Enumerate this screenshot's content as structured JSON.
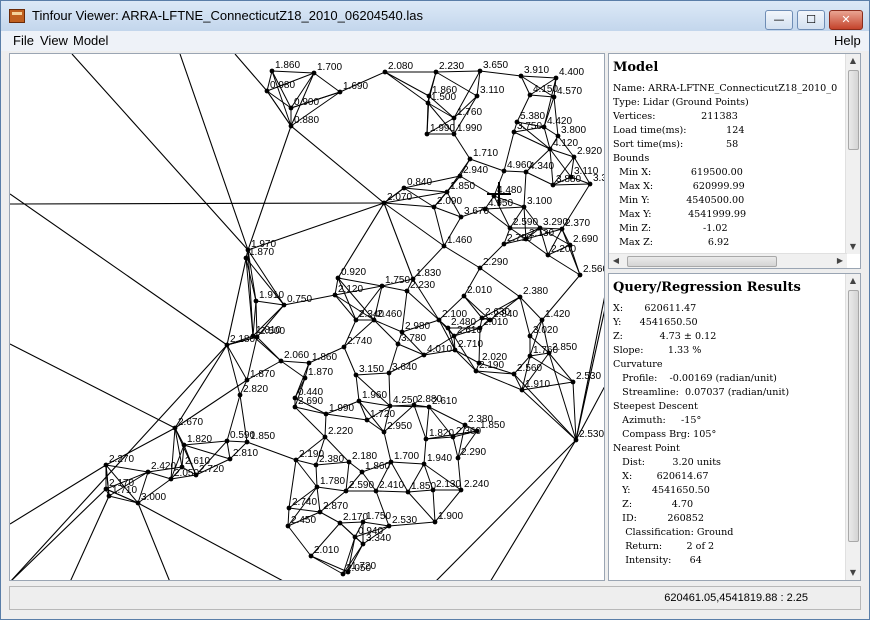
{
  "window": {
    "title": "Tinfour Viewer: ARRA-LFTNE_ConnecticutZ18_2010_06204540.las",
    "min_glyph": "—",
    "max_glyph": "☐",
    "close_glyph": "✕"
  },
  "menu": {
    "file": "File",
    "view": "View",
    "model": "Model",
    "help": "Help"
  },
  "model_panel": {
    "title": "Model",
    "body": "Name: ARRA-LFTNE_ConnecticutZ18_2010_0\nType: Lidar (Ground Points)\nVertices:               211383\nLoad time(ms):             124\nSort time(ms):              58\nBounds\n  Min X:             619500.00\n  Max X:             620999.99\n  Min Y:            4540500.00\n  Max Y:            4541999.99\n  Min Z:                 -1.02\n  Max Z:                  6.92"
  },
  "query_panel": {
    "title": "Query/Regression Results",
    "body": "X:       620611.47\nY:      4541650.50\nZ:            4.73 ± 0.12\nSlope:        1.33 %\nCurvature\n   Profile:    -0.00169 (radian/unit)\n   Streamline:  0.07037 (radian/unit)\nSteepest Descent\n   Azimuth:     -15°\n   Compass Brg: 105°\nNearest Point\n   Dist:         3.20 units\n   X:        620614.67\n   Y:       4541650.50\n   Z:             4.70\n   ID:          260852\n    Classification: Ground\n    Return:        2 of 2\n    Intensity:      64"
  },
  "status": {
    "coords": "620461.05,4541819.88 : 2.25"
  },
  "tin": {
    "points": [
      {
        "label": "1.860",
        "z": 1.86
      },
      {
        "label": "1.700",
        "z": 1.7
      },
      {
        "label": "2.080",
        "z": 2.08
      },
      {
        "label": "2.230",
        "z": 2.23
      },
      {
        "label": "3.650",
        "z": 3.65
      },
      {
        "label": "3.910",
        "z": 3.91
      },
      {
        "label": "4.400",
        "z": 4.4
      },
      {
        "label": "0.980",
        "z": 0.98
      },
      {
        "label": "1.690",
        "z": 1.69
      },
      {
        "label": "1.860",
        "z": 1.86
      },
      {
        "label": "3.110",
        "z": 3.11
      },
      {
        "label": "4.150",
        "z": 4.15
      },
      {
        "label": "4.570",
        "z": 4.57
      },
      {
        "label": "0.900",
        "z": 0.9
      },
      {
        "label": "1.500",
        "z": 1.5
      },
      {
        "label": "0.880",
        "z": 0.88
      },
      {
        "label": "1.760",
        "z": 1.76
      },
      {
        "label": "5.380",
        "z": 5.38
      },
      {
        "label": "4.420",
        "z": 4.42
      },
      {
        "label": "1.990",
        "z": 1.99
      },
      {
        "label": "1.990",
        "z": 1.99
      },
      {
        "label": "3.750",
        "z": 3.75
      },
      {
        "label": "3.800",
        "z": 3.8
      },
      {
        "label": "4.120",
        "z": 4.12
      },
      {
        "label": "1.710",
        "z": 1.71
      },
      {
        "label": "2.920",
        "z": 2.92
      },
      {
        "label": "4.960",
        "z": 4.96
      },
      {
        "label": "4.340",
        "z": 4.34
      },
      {
        "label": "2.940",
        "z": 2.94
      },
      {
        "label": "3.110",
        "z": 3.11
      },
      {
        "label": "3.880",
        "z": 3.88
      },
      {
        "label": "3.360",
        "z": 3.36
      },
      {
        "label": "0.840",
        "z": 0.84
      },
      {
        "label": "1.850",
        "z": 1.85
      },
      {
        "label": "4.480",
        "z": 4.48
      },
      {
        "label": "2.070",
        "z": 2.07
      },
      {
        "label": "2.090",
        "z": 2.09
      },
      {
        "label": "4.950",
        "z": 4.95
      },
      {
        "label": "3.100",
        "z": 3.1
      },
      {
        "label": "3.670",
        "z": 3.67
      },
      {
        "label": "2.590",
        "z": 2.59
      },
      {
        "label": "3.290",
        "z": 3.29
      },
      {
        "label": "2.130",
        "z": 2.13
      },
      {
        "label": "2.370",
        "z": 2.37
      },
      {
        "label": "1.460",
        "z": 1.46
      },
      {
        "label": "2.790",
        "z": 2.79
      },
      {
        "label": "2.690",
        "z": 2.69
      },
      {
        "label": "1.970",
        "z": 1.97
      },
      {
        "label": "1.870",
        "z": 1.87
      },
      {
        "label": "2.200",
        "z": 2.2
      },
      {
        "label": "2.290",
        "z": 2.29
      },
      {
        "label": "0.920",
        "z": 0.92
      },
      {
        "label": "2.560",
        "z": 2.56
      },
      {
        "label": "1.830",
        "z": 1.83
      },
      {
        "label": "2.010",
        "z": 2.01
      },
      {
        "label": "2.120",
        "z": 2.12
      },
      {
        "label": "1.750",
        "z": 1.75
      },
      {
        "label": "2.230",
        "z": 2.23
      },
      {
        "label": "2.010",
        "z": 2.01
      },
      {
        "label": "2.380",
        "z": 2.38
      },
      {
        "label": "1.910",
        "z": 1.91
      },
      {
        "label": "0.750",
        "z": 0.75
      },
      {
        "label": "2.630",
        "z": 2.63
      },
      {
        "label": "2.340",
        "z": 2.34
      },
      {
        "label": "2.460",
        "z": 2.46
      },
      {
        "label": "2.100",
        "z": 2.1
      },
      {
        "label": "2.840",
        "z": 2.84
      },
      {
        "label": "1.420",
        "z": 1.42
      },
      {
        "label": "1.810",
        "z": 1.81
      },
      {
        "label": "2.980",
        "z": 2.98
      },
      {
        "label": "2.480",
        "z": 2.48
      },
      {
        "label": "2.610",
        "z": 2.61
      },
      {
        "label": "3.020",
        "z": 3.02
      },
      {
        "label": "2.180",
        "z": 2.18
      },
      {
        "label": "2.500",
        "z": 2.5
      },
      {
        "label": "2.740",
        "z": 2.74
      },
      {
        "label": "3.780",
        "z": 3.78
      },
      {
        "label": "2.710",
        "z": 2.71
      },
      {
        "label": "2.850",
        "z": 2.85
      },
      {
        "label": "4.010",
        "z": 4.01
      },
      {
        "label": "1.760",
        "z": 1.76
      },
      {
        "label": "2.060",
        "z": 2.06
      },
      {
        "label": "1.860",
        "z": 1.86
      },
      {
        "label": "2.020",
        "z": 2.02
      },
      {
        "label": "1.870",
        "z": 1.87
      },
      {
        "label": "2.190",
        "z": 2.19
      },
      {
        "label": "1.870",
        "z": 1.87
      },
      {
        "label": "3.150",
        "z": 3.15
      },
      {
        "label": "3.640",
        "z": 3.64
      },
      {
        "label": "2.560",
        "z": 2.56
      },
      {
        "label": "2.530",
        "z": 2.53
      },
      {
        "label": "2.820",
        "z": 2.82
      },
      {
        "label": "1.910",
        "z": 1.91
      },
      {
        "label": "0.440",
        "z": 0.44
      },
      {
        "label": "1.960",
        "z": 1.96
      },
      {
        "label": "2.880",
        "z": 2.88
      },
      {
        "label": "4.250",
        "z": 4.25
      },
      {
        "label": "2.610",
        "z": 2.61
      },
      {
        "label": "2.690",
        "z": 2.69
      },
      {
        "label": "1.990",
        "z": 1.99
      },
      {
        "label": "1.720",
        "z": 1.72
      },
      {
        "label": "2.380",
        "z": 2.38
      },
      {
        "label": "1.850",
        "z": 1.85
      },
      {
        "label": "2.950",
        "z": 2.95
      },
      {
        "label": "2.360",
        "z": 2.36
      },
      {
        "label": "2.530",
        "z": 2.53
      },
      {
        "label": "2.670",
        "z": 2.67
      },
      {
        "label": "0.590",
        "z": 0.59
      },
      {
        "label": "1.850",
        "z": 1.85
      },
      {
        "label": "1.820",
        "z": 1.82
      },
      {
        "label": "2.220",
        "z": 2.22
      },
      {
        "label": "1.820",
        "z": 1.82
      },
      {
        "label": "2.610",
        "z": 2.61
      },
      {
        "label": "2.810",
        "z": 2.81
      },
      {
        "label": "2.190",
        "z": 2.19
      },
      {
        "label": "2.270",
        "z": 2.27
      },
      {
        "label": "2.380",
        "z": 2.38
      },
      {
        "label": "2.180",
        "z": 2.18
      },
      {
        "label": "1.700",
        "z": 1.7
      },
      {
        "label": "1.940",
        "z": 1.94
      },
      {
        "label": "2.290",
        "z": 2.29
      },
      {
        "label": "2.420",
        "z": 2.42
      },
      {
        "label": "2.720",
        "z": 2.72
      },
      {
        "label": "1.860",
        "z": 1.86
      },
      {
        "label": "2.050",
        "z": 2.05
      },
      {
        "label": "1.780",
        "z": 1.78
      },
      {
        "label": "2.170",
        "z": 2.17
      },
      {
        "label": "1.710",
        "z": 1.71
      },
      {
        "label": "3.000",
        "z": 3.0
      },
      {
        "label": "2.590",
        "z": 2.59
      },
      {
        "label": "2.410",
        "z": 2.41
      },
      {
        "label": "1.850",
        "z": 1.85
      },
      {
        "label": "2.130",
        "z": 2.13
      },
      {
        "label": "2.240",
        "z": 2.24
      },
      {
        "label": "2.740",
        "z": 2.74
      },
      {
        "label": "2.870",
        "z": 2.87
      },
      {
        "label": "2.450",
        "z": 2.45
      },
      {
        "label": "2.170",
        "z": 2.17
      },
      {
        "label": "1.750",
        "z": 1.75
      },
      {
        "label": "2.530",
        "z": 2.53
      },
      {
        "label": "1.900",
        "z": 1.9
      },
      {
        "label": "0.940",
        "z": 0.94
      },
      {
        "label": "3.340",
        "z": 3.34
      },
      {
        "label": "2.010",
        "z": 2.01
      },
      {
        "label": "1.720",
        "z": 1.72
      },
      {
        "label": "2.050",
        "z": 2.05
      },
      {
        "label": "2.880",
        "z": 2.88
      },
      {
        "label": "2.070",
        "z": 2.07
      }
    ]
  }
}
